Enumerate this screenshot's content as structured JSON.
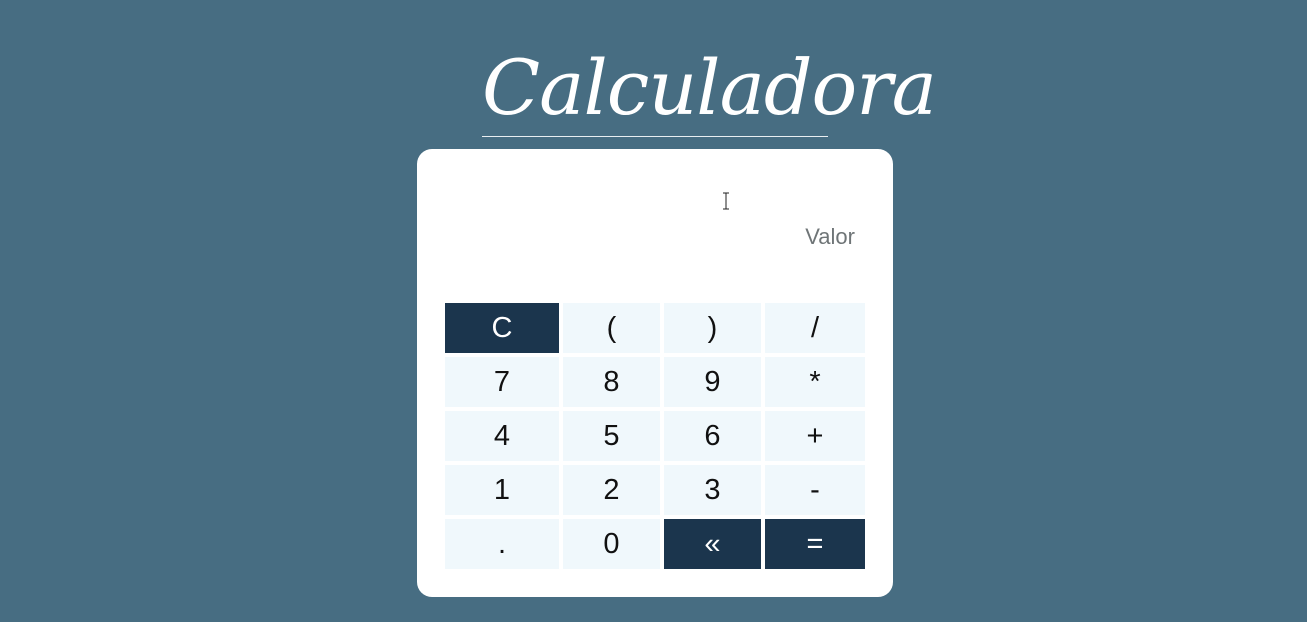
{
  "title": "Calculadora",
  "display": {
    "value": "",
    "placeholder": "Valor"
  },
  "keys": [
    {
      "label": "C",
      "style": "dark"
    },
    {
      "label": "(",
      "style": "light"
    },
    {
      "label": ")",
      "style": "light"
    },
    {
      "label": "/",
      "style": "light"
    },
    {
      "label": "7",
      "style": "light"
    },
    {
      "label": "8",
      "style": "light"
    },
    {
      "label": "9",
      "style": "light"
    },
    {
      "label": "*",
      "style": "light"
    },
    {
      "label": "4",
      "style": "light"
    },
    {
      "label": "5",
      "style": "light"
    },
    {
      "label": "6",
      "style": "light"
    },
    {
      "label": "+",
      "style": "light"
    },
    {
      "label": "1",
      "style": "light"
    },
    {
      "label": "2",
      "style": "light"
    },
    {
      "label": "3",
      "style": "light"
    },
    {
      "label": "-",
      "style": "light"
    },
    {
      "label": ".",
      "style": "light"
    },
    {
      "label": "0",
      "style": "light"
    },
    {
      "label": "«",
      "style": "dark"
    },
    {
      "label": "=",
      "style": "dark"
    }
  ],
  "colors": {
    "background": "#476d82",
    "card": "#ffffff",
    "key_light": "#f0f8fc",
    "key_dark": "#1b354d"
  }
}
